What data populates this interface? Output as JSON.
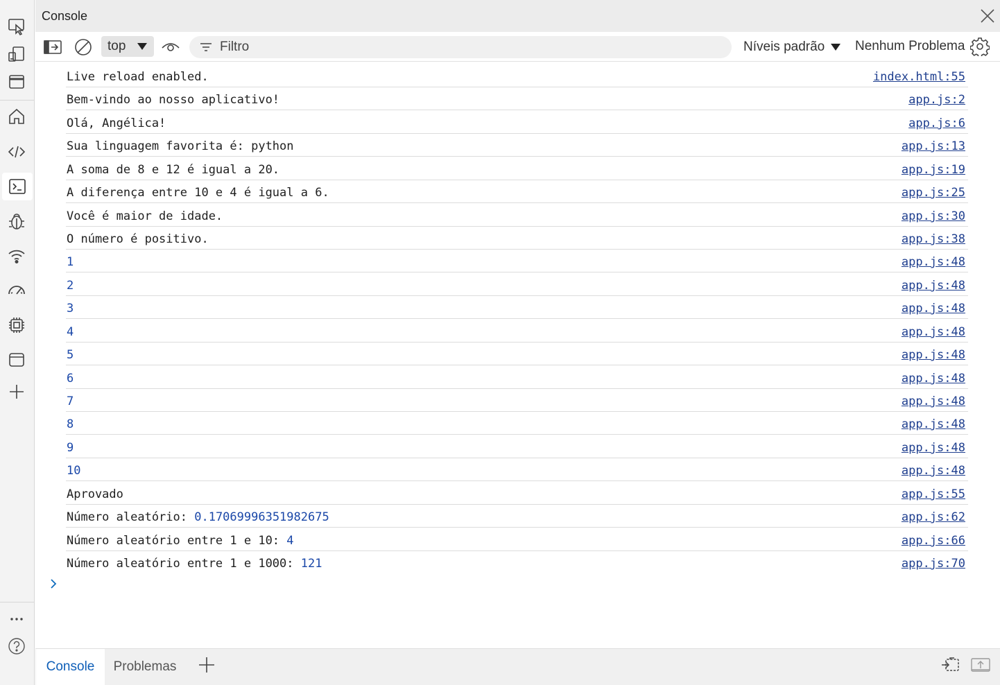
{
  "titlebar": {
    "title": "Console"
  },
  "toolbar": {
    "context_value": "top",
    "filter_placeholder": "Filtro",
    "levels_label": "Níveis padrão",
    "issues_label": "Nenhum Problema"
  },
  "console": {
    "rows": [
      {
        "text": "Live reload enabled.",
        "value": "",
        "source": "index.html:55"
      },
      {
        "text": "Bem-vindo ao nosso aplicativo!",
        "value": "",
        "source": "app.js:2"
      },
      {
        "text": "Olá, Angélica!",
        "value": "",
        "source": "app.js:6"
      },
      {
        "text": "Sua linguagem favorita é: python",
        "value": "",
        "source": "app.js:13"
      },
      {
        "text": "A soma de 8 e 12 é igual a 20.",
        "value": "",
        "source": "app.js:19"
      },
      {
        "text": "A diferença entre 10 e 4 é igual a 6.",
        "value": "",
        "source": "app.js:25"
      },
      {
        "text": "Você é maior de idade.",
        "value": "",
        "source": "app.js:30"
      },
      {
        "text": "O número é positivo.",
        "value": "",
        "source": "app.js:38"
      },
      {
        "text": "",
        "value": "1",
        "source": "app.js:48"
      },
      {
        "text": "",
        "value": "2",
        "source": "app.js:48"
      },
      {
        "text": "",
        "value": "3",
        "source": "app.js:48"
      },
      {
        "text": "",
        "value": "4",
        "source": "app.js:48"
      },
      {
        "text": "",
        "value": "5",
        "source": "app.js:48"
      },
      {
        "text": "",
        "value": "6",
        "source": "app.js:48"
      },
      {
        "text": "",
        "value": "7",
        "source": "app.js:48"
      },
      {
        "text": "",
        "value": "8",
        "source": "app.js:48"
      },
      {
        "text": "",
        "value": "9",
        "source": "app.js:48"
      },
      {
        "text": "",
        "value": "10",
        "source": "app.js:48"
      },
      {
        "text": "Aprovado",
        "value": "",
        "source": "app.js:55"
      },
      {
        "text": "Número aleatório: ",
        "value": "0.17069996351982675",
        "source": "app.js:62"
      },
      {
        "text": "Número aleatório entre 1 e 10: ",
        "value": "4",
        "source": "app.js:66"
      },
      {
        "text": "Número aleatório entre 1 e 1000: ",
        "value": "121",
        "source": "app.js:70"
      }
    ]
  },
  "drawer": {
    "tab_console": "Console",
    "tab_problems": "Problemas"
  },
  "colors": {
    "accent": "#0f6cbd",
    "link": "#1f3f8f",
    "number": "#1a47a8"
  },
  "icons": {
    "activity_bar": [
      "inspect-icon",
      "device-emulation-icon",
      "welcome-icon",
      "home-icon",
      "sources-icon",
      "console-icon",
      "debug-icon",
      "network-icon",
      "performance-icon",
      "memory-icon",
      "application-icon",
      "add-tool-icon",
      "more-tools-icon",
      "help-icon"
    ]
  }
}
